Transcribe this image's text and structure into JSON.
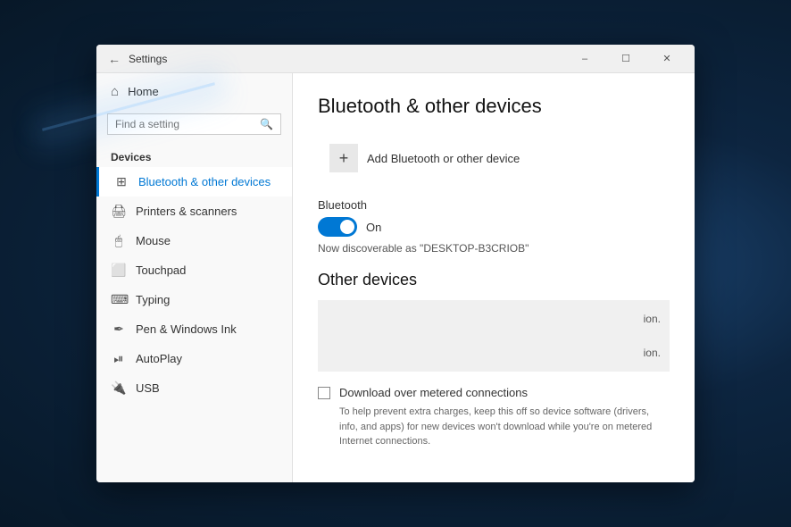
{
  "window": {
    "title": "Settings",
    "min_label": "–",
    "max_label": "☐",
    "close_label": "✕"
  },
  "sidebar": {
    "back_icon": "←",
    "home_label": "Home",
    "search_placeholder": "Find a setting",
    "search_icon": "🔍",
    "devices_section": "Devices",
    "items": [
      {
        "id": "bluetooth",
        "label": "Bluetooth & other devices",
        "icon": "⊞",
        "active": true
      },
      {
        "id": "printers",
        "label": "Printers & scanners",
        "icon": "🖨",
        "active": false
      },
      {
        "id": "mouse",
        "label": "Mouse",
        "icon": "🖱",
        "active": false
      },
      {
        "id": "touchpad",
        "label": "Touchpad",
        "icon": "⬜",
        "active": false
      },
      {
        "id": "typing",
        "label": "Typing",
        "icon": "⌨",
        "active": false
      },
      {
        "id": "pen",
        "label": "Pen & Windows Ink",
        "icon": "✒",
        "active": false
      },
      {
        "id": "autoplay",
        "label": "AutoPlay",
        "icon": "⏯",
        "active": false
      },
      {
        "id": "usb",
        "label": "USB",
        "icon": "🔌",
        "active": false
      }
    ]
  },
  "content": {
    "title": "Bluetooth & other devices",
    "add_device_label": "Add Bluetooth or other device",
    "add_icon": "+",
    "bluetooth_section_label": "Bluetooth",
    "bluetooth_toggle_label": "On",
    "discoverable_text": "Now discoverable as \"DESKTOP-B3CRIOB\"",
    "other_devices_title": "Other devices",
    "other_devices_text1": "ion.",
    "other_devices_text2": "ion.",
    "download_label": "Download over metered connections",
    "download_desc": "To help prevent extra charges, keep this off so device software (drivers, info, and apps) for new devices won't download while you're on metered Internet connections."
  }
}
